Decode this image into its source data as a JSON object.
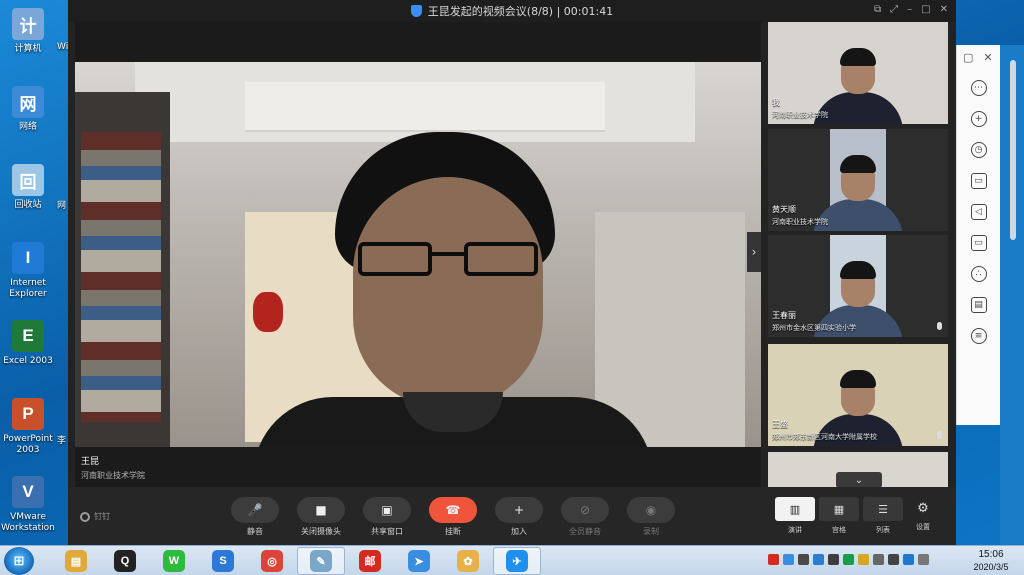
{
  "desktop": {
    "icons": [
      {
        "label": "计算机",
        "icon": "computer-icon",
        "color": "#7aa7d8"
      },
      {
        "label": "网络",
        "icon": "network-icon",
        "color": "#3d8ad6"
      },
      {
        "label": "回收站",
        "icon": "recycle-bin-icon",
        "color": "#9cc6e6"
      },
      {
        "label": "Internet\nExplorer",
        "icon": "internet-explorer-icon",
        "color": "#1f7ad6"
      },
      {
        "label": "Excel 2003",
        "icon": "excel-icon",
        "color": "#1f7a3a"
      },
      {
        "label": "PowerPoint\n2003",
        "icon": "powerpoint-icon",
        "color": "#c8502a"
      },
      {
        "label": "VMware\nWorkstation",
        "icon": "vmware-icon",
        "color": "#3a6fb0"
      }
    ],
    "edge_letters": [
      "Wi",
      "网",
      "李"
    ]
  },
  "meeting": {
    "title": "王昆发起的视频会议(8/8) | 00:01:41",
    "main_speaker": {
      "name": "王昆",
      "org": "河南职业技术学院"
    },
    "participants": [
      {
        "name": "我",
        "org": "河南职业技术学院",
        "style": "full",
        "bg": "#d7d4cf"
      },
      {
        "name": "黄天顺",
        "org": "河南职业技术学院",
        "style": "narrow",
        "bg": "#b7bfca"
      },
      {
        "name": "王春丽",
        "org": "郑州市金水区第四实验小学",
        "style": "narrow",
        "bg": "#c9d3de"
      },
      {
        "name": "王盛",
        "org": "郑州市郑东新区河南大学附属学校",
        "style": "full",
        "bg": "#dad2b6"
      }
    ],
    "toolbar": {
      "brand": "钉钉",
      "tools": [
        {
          "label": "静音",
          "icon": "microphone-icon",
          "glyph": "🎤",
          "enabled": true
        },
        {
          "label": "关闭摄像头",
          "icon": "camera-icon",
          "glyph": "■",
          "enabled": true
        },
        {
          "label": "共享窗口",
          "icon": "share-screen-icon",
          "glyph": "▣",
          "enabled": true
        },
        {
          "label": "挂断",
          "icon": "hang-up-icon",
          "glyph": "☎",
          "enabled": true,
          "danger": true
        },
        {
          "label": "加入",
          "icon": "add-person-icon",
          "glyph": "+",
          "enabled": true
        },
        {
          "label": "全员静音",
          "icon": "mute-all-icon",
          "glyph": "⊘",
          "enabled": false
        },
        {
          "label": "录制",
          "icon": "record-icon",
          "glyph": "◉",
          "enabled": false
        }
      ],
      "layouts": [
        {
          "label": "演讲",
          "icon": "speaker-layout-icon",
          "glyph": "▥",
          "active": true
        },
        {
          "label": "宫格",
          "icon": "grid-layout-icon",
          "glyph": "▦",
          "active": false
        },
        {
          "label": "列表",
          "icon": "list-layout-icon",
          "glyph": "☰",
          "active": false
        }
      ],
      "settings_label": "设置"
    }
  },
  "taskbar": {
    "apps": [
      {
        "icon": "file-explorer-icon",
        "glyph": "▤",
        "color": "#e0a93a",
        "active": false
      },
      {
        "icon": "qq-icon",
        "glyph": "Q",
        "color": "#222222",
        "active": false
      },
      {
        "icon": "wechat-icon",
        "glyph": "W",
        "color": "#2dbb3e",
        "active": false
      },
      {
        "icon": "sogou-icon",
        "glyph": "S",
        "color": "#2b78d6",
        "active": false
      },
      {
        "icon": "chrome-icon",
        "glyph": "◎",
        "color": "#db4437",
        "active": false
      },
      {
        "icon": "notepad-icon",
        "glyph": "✎",
        "color": "#7aa6c8",
        "active": true
      },
      {
        "icon": "mail-app-icon",
        "glyph": "邮",
        "color": "#d42a1f",
        "active": false
      },
      {
        "icon": "feige-icon",
        "glyph": "➤",
        "color": "#3b8de0",
        "active": false
      },
      {
        "icon": "paint-icon",
        "glyph": "✿",
        "color": "#e8b04a",
        "active": false
      },
      {
        "icon": "dingtalk-icon",
        "glyph": "✈",
        "color": "#1f8ff0",
        "active": true
      }
    ],
    "tray_colors": [
      "#d42a1f",
      "#3b8de0",
      "#4a4a4a",
      "#2a7dd1",
      "#3d3d3d",
      "#1b9b4b",
      "#d8a42a",
      "#666666",
      "#444444",
      "#2277cc",
      "#777777"
    ],
    "time": "15:06",
    "date": "2020/3/5"
  }
}
